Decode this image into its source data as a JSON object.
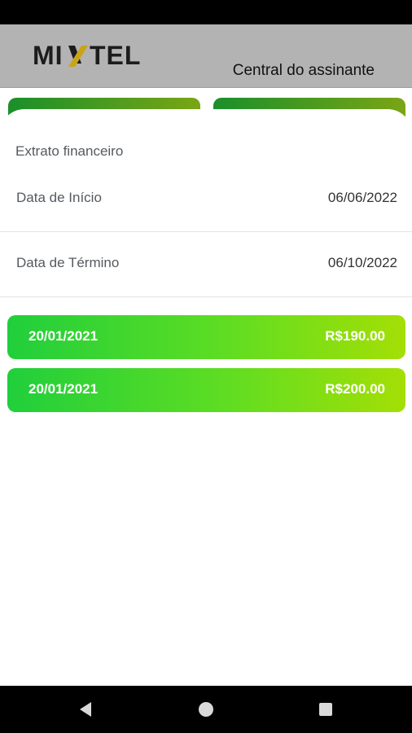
{
  "app": {
    "logo_text": "MIXTEL",
    "header_title": "Central do assinante"
  },
  "sheet": {
    "title": "Extrato financeiro",
    "start_label": "Data de Início",
    "start_value": "06/06/2022",
    "end_label": "Data de Término",
    "end_value": "06/10/2022"
  },
  "transactions": [
    {
      "date": "20/01/2021",
      "amount": "R$190.00"
    },
    {
      "date": "20/01/2021",
      "amount": "R$200.00"
    }
  ],
  "colors": {
    "accent_green": "#20cf3c",
    "accent_lime": "#a4df05",
    "logo_x_accent": "#c9a318"
  },
  "icons": {
    "nav_back": "back-triangle-icon",
    "nav_home": "home-circle-icon",
    "nav_recent": "recents-square-icon"
  }
}
